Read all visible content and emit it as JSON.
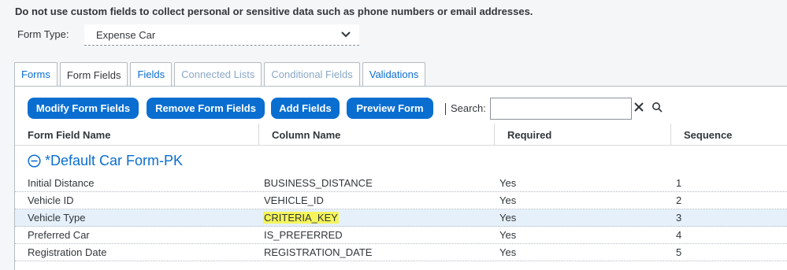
{
  "notice": "Do not use custom fields to collect personal or sensitive data such as phone numbers or email addresses.",
  "form_type": {
    "label": "Form Type:",
    "value": "Expense Car"
  },
  "tabs": [
    {
      "label": "Forms",
      "state": "normal"
    },
    {
      "label": "Form Fields",
      "state": "active"
    },
    {
      "label": "Fields",
      "state": "normal"
    },
    {
      "label": "Connected Lists",
      "state": "disabled"
    },
    {
      "label": "Conditional Fields",
      "state": "disabled"
    },
    {
      "label": "Validations",
      "state": "normal"
    }
  ],
  "toolbar": {
    "modify": "Modify Form Fields",
    "remove": "Remove Form Fields",
    "add": "Add Fields",
    "preview": "Preview Form",
    "search_label": "Search:"
  },
  "table": {
    "headers": [
      "Form Field Name",
      "Column Name",
      "Required",
      "Sequence"
    ],
    "group": "*Default Car Form-PK",
    "rows": [
      [
        "Initial Distance",
        "BUSINESS_DISTANCE",
        "Yes",
        "1"
      ],
      [
        "Vehicle ID",
        "VEHICLE_ID",
        "Yes",
        "2"
      ],
      [
        "Vehicle Type",
        "CRITERIA_KEY",
        "Yes",
        "3"
      ],
      [
        "Preferred Car",
        "IS_PREFERRED",
        "Yes",
        "4"
      ],
      [
        "Registration Date",
        "REGISTRATION_DATE",
        "Yes",
        "5"
      ]
    ]
  },
  "colors": {
    "accent": "#0a6ed1",
    "highlight": "#f4f55a",
    "selected_row": "#e5f0fa"
  }
}
